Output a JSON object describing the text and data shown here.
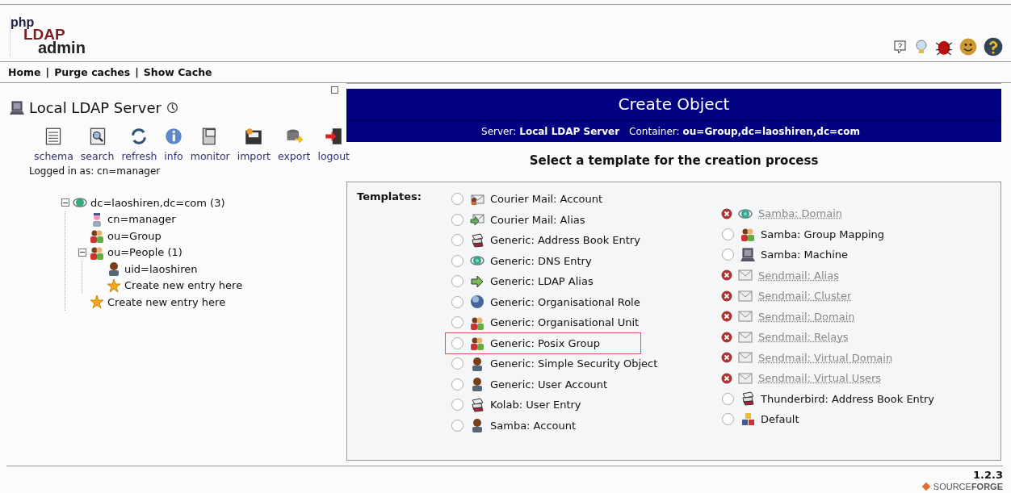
{
  "logo": {
    "line_1": "php",
    "line_2": "LDAP",
    "line_3": "admin"
  },
  "nav": {
    "links": [
      "Home",
      "Purge caches",
      "Show Cache"
    ],
    "separator": "|"
  },
  "server": {
    "name": "Local LDAP Server",
    "tools": [
      "schema",
      "search",
      "refresh",
      "info",
      "monitor",
      "import",
      "export",
      "logout"
    ],
    "logged_in": "Logged in as: cn=manager",
    "tree": [
      {
        "label": "dc=laoshiren,dc=com (3)",
        "kind": "domain",
        "expanded": true,
        "children": [
          {
            "label": "cn=manager",
            "kind": "person"
          },
          {
            "label": "ou=Group",
            "kind": "group"
          },
          {
            "label": "ou=People (1)",
            "kind": "group",
            "expanded": true,
            "children": [
              {
                "label": "uid=laoshiren",
                "kind": "user"
              },
              {
                "label": "Create new entry here",
                "kind": "create"
              }
            ]
          },
          {
            "label": "Create new entry here",
            "kind": "create"
          }
        ]
      }
    ]
  },
  "panel": {
    "title": "Create Object",
    "server_label": "Server:",
    "server_value": "Local LDAP Server",
    "container_label": "Container:",
    "container_value": "ou=Group,dc=laoshiren,dc=com",
    "subtitle": "Select a template for the creation process",
    "templates_label": "Templates:",
    "templates": [
      [
        {
          "label": "Courier Mail: Account",
          "kind": "mail-user",
          "available": true,
          "selected": false,
          "highlighted": false
        },
        {
          "label": "Courier Mail: Alias",
          "kind": "mail-arrow",
          "available": true,
          "selected": false,
          "highlighted": false
        },
        {
          "label": "Generic: Address Book Entry",
          "kind": "addressbook",
          "available": true,
          "selected": false,
          "highlighted": false
        },
        {
          "label": "Generic: DNS Entry",
          "kind": "network",
          "available": true,
          "selected": false,
          "highlighted": false
        },
        {
          "label": "Generic: LDAP Alias",
          "kind": "arrow",
          "available": true,
          "selected": false,
          "highlighted": false
        },
        {
          "label": "Generic: Organisational Role",
          "kind": "globe",
          "available": true,
          "selected": false,
          "highlighted": false
        },
        {
          "label": "Generic: Organisational Unit",
          "kind": "group",
          "available": true,
          "selected": false,
          "highlighted": false
        },
        {
          "label": "Generic: Posix Group",
          "kind": "group",
          "available": true,
          "selected": false,
          "highlighted": true
        },
        {
          "label": "Generic: Simple Security Object",
          "kind": "user",
          "available": true,
          "selected": false,
          "highlighted": false
        },
        {
          "label": "Generic: User Account",
          "kind": "user",
          "available": true,
          "selected": false,
          "highlighted": false
        },
        {
          "label": "Kolab: User Entry",
          "kind": "addressbook",
          "available": true,
          "selected": false,
          "highlighted": false
        },
        {
          "label": "Samba: Account",
          "kind": "user",
          "available": true,
          "selected": false,
          "highlighted": false
        }
      ],
      [
        {
          "label": "Samba: Domain",
          "kind": "network",
          "available": false,
          "highlighted": false
        },
        {
          "label": "Samba: Group Mapping",
          "kind": "group",
          "available": true,
          "selected": false,
          "highlighted": false
        },
        {
          "label": "Samba: Machine",
          "kind": "computer",
          "available": true,
          "selected": false,
          "highlighted": false
        },
        {
          "label": "Sendmail: Alias",
          "kind": "mail",
          "available": false,
          "highlighted": false
        },
        {
          "label": "Sendmail: Cluster",
          "kind": "mail",
          "available": false,
          "highlighted": false
        },
        {
          "label": "Sendmail: Domain",
          "kind": "mail",
          "available": false,
          "highlighted": false
        },
        {
          "label": "Sendmail: Relays",
          "kind": "mail",
          "available": false,
          "highlighted": false
        },
        {
          "label": "Sendmail: Virtual Domain",
          "kind": "mail",
          "available": false,
          "highlighted": false
        },
        {
          "label": "Sendmail: Virtual Users",
          "kind": "mail",
          "available": false,
          "highlighted": false
        },
        {
          "label": "Thunderbird: Address Book Entry",
          "kind": "addressbook",
          "available": true,
          "selected": false,
          "highlighted": false
        },
        {
          "label": "Default",
          "kind": "blocks",
          "available": true,
          "selected": false,
          "highlighted": false
        }
      ]
    ]
  },
  "footer": {
    "version": "1.2.3",
    "sourceforge": "SOURCE**FORGE**"
  }
}
